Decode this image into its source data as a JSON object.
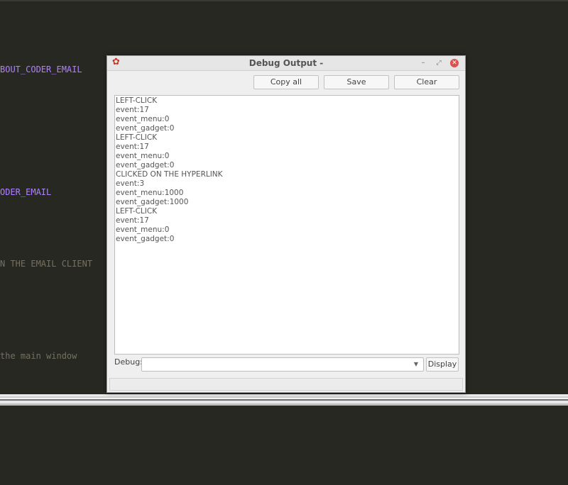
{
  "background_editor": {
    "lines": [
      {
        "text": "BOUT_CODER_EMAIL",
        "kind": "const"
      },
      {
        "text": "ODER_EMAIL",
        "kind": "const"
      },
      {
        "text": "N THE EMAIL CLIENT",
        "kind": "comment"
      },
      {
        "text": "the main window",
        "kind": "comment"
      }
    ]
  },
  "dialog": {
    "title": "Debug Output -",
    "icon": "app-lizard-icon",
    "window_buttons": {
      "minimize": "–",
      "maximize": "⤢",
      "close": "✕"
    },
    "toolbar": {
      "copy_all_label": "Copy all",
      "save_label": "Save",
      "clear_label": "Clear"
    },
    "output_lines": [
      "LEFT-CLICK",
      "event:17",
      "event_menu:0",
      "event_gadget:0",
      "LEFT-CLICK",
      "event:17",
      "event_menu:0",
      "event_gadget:0",
      "CLICKED ON THE HYPERLINK",
      "event:3",
      "event_menu:1000",
      "event_gadget:1000",
      "LEFT-CLICK",
      "event:17",
      "event_menu:0",
      "event_gadget:0"
    ],
    "debug": {
      "label": "Debug:",
      "value": "",
      "display_label": "Display"
    }
  },
  "colors": {
    "editor_bg": "#272822",
    "const": "#ae81ff",
    "comment": "#75715e",
    "close_button": "#d9534f"
  }
}
